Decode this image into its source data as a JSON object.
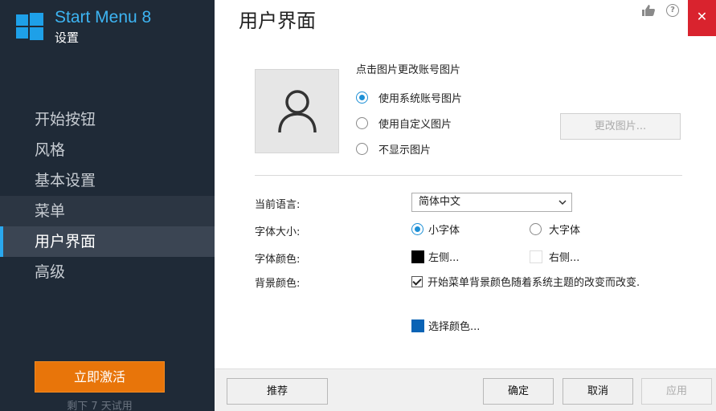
{
  "sidebar": {
    "app_title": "Start Menu 8",
    "app_subtitle": "设置",
    "nav_items": [
      {
        "label": "开始按钮"
      },
      {
        "label": "风格"
      },
      {
        "label": "基本设置"
      },
      {
        "label": "菜单"
      },
      {
        "label": "用户界面"
      },
      {
        "label": "高级"
      }
    ],
    "activate_label": "立即激活",
    "trial_text": "剩下 7 天试用",
    "colors": {
      "background": "#1f2a37",
      "accent": "#2aa8ee",
      "activate": "#e8750a"
    }
  },
  "header": {
    "title": "用户界面",
    "icons": [
      "thumbs-up-icon",
      "help-icon",
      "close-icon"
    ],
    "close_glyph": "✕"
  },
  "account_picture": {
    "caption": "点击图片更改账号图片",
    "options": [
      {
        "label": "使用系统账号图片",
        "selected": true
      },
      {
        "label": "使用自定义图片",
        "selected": false
      },
      {
        "label": "不显示图片",
        "selected": false
      }
    ],
    "change_button": "更改图片..."
  },
  "settings": {
    "language_label": "当前语言:",
    "language_value": "简体中文",
    "font_size_label": "字体大小:",
    "font_size_options": [
      {
        "label": "小字体",
        "selected": true
      },
      {
        "label": "大字体",
        "selected": false
      }
    ],
    "font_color_label": "字体颜色:",
    "font_color_left": {
      "label": "左侧...",
      "color": "#000000"
    },
    "font_color_right": {
      "label": "右侧...",
      "color": "#ffffff"
    },
    "bg_color_label": "背景颜色:",
    "bg_follow_theme": {
      "label": "开始菜单背景颜色随着系统主题的改变而改变.",
      "checked": true
    },
    "choose_color": {
      "label": "选择颜色...",
      "color": "#0a63b5"
    }
  },
  "footer": {
    "recommend": "推荐",
    "ok": "确定",
    "cancel": "取消",
    "apply": "应用"
  }
}
